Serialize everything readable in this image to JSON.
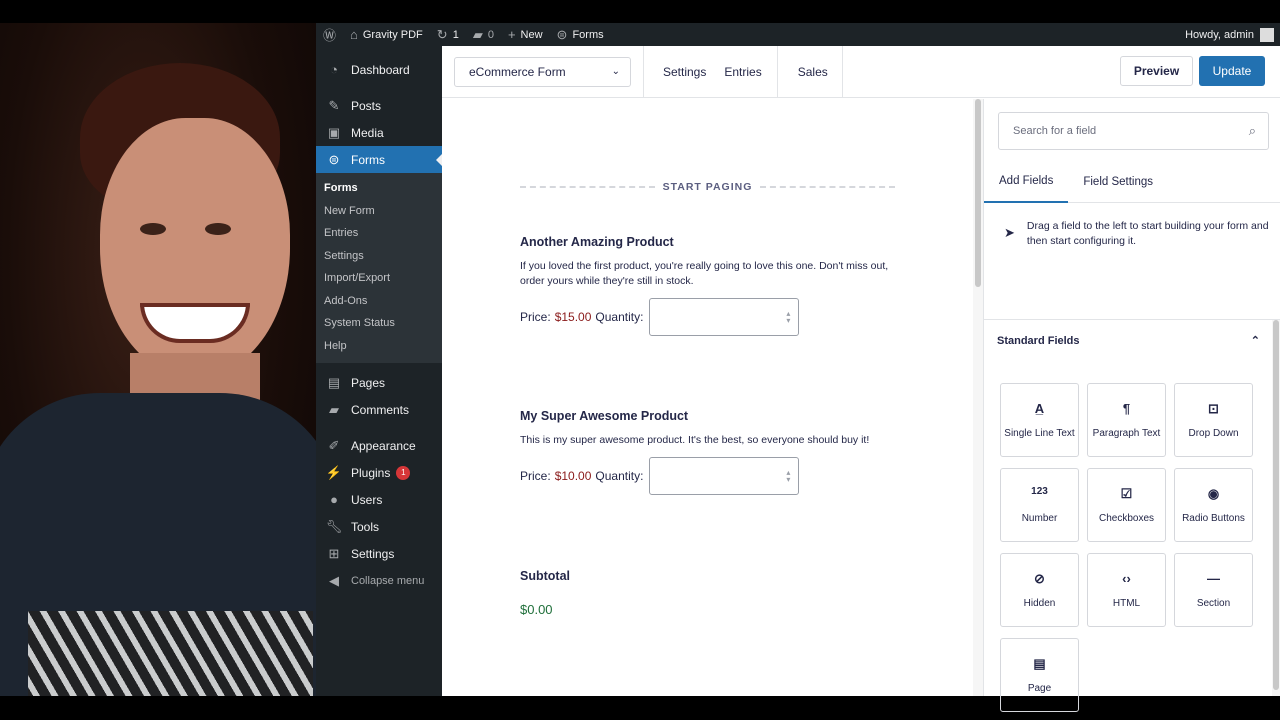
{
  "adminbar": {
    "site_name": "Gravity PDF",
    "updates_count": "1",
    "comments_count": "0",
    "new_label": "New",
    "forms_label": "Forms",
    "greeting": "Howdy, admin"
  },
  "sidebar": {
    "top_items": [
      {
        "label": "Dashboard",
        "icon": "dashboard-icon"
      },
      {
        "label": "Posts",
        "icon": "pin-icon"
      },
      {
        "label": "Media",
        "icon": "media-icon"
      },
      {
        "label": "Forms",
        "icon": "forms-icon"
      }
    ],
    "forms_submenu": [
      "Forms",
      "New Form",
      "Entries",
      "Settings",
      "Import/Export",
      "Add-Ons",
      "System Status",
      "Help"
    ],
    "bottom_items": [
      {
        "label": "Pages",
        "icon": "pages-icon"
      },
      {
        "label": "Comments",
        "icon": "comment-icon"
      },
      {
        "label": "Appearance",
        "icon": "brush-icon"
      },
      {
        "label": "Plugins",
        "icon": "plugin-icon",
        "badge": "1"
      },
      {
        "label": "Users",
        "icon": "users-icon"
      },
      {
        "label": "Tools",
        "icon": "wrench-icon"
      },
      {
        "label": "Settings",
        "icon": "settings-icon"
      }
    ],
    "collapse_label": "Collapse menu"
  },
  "toolbar": {
    "form_name": "eCommerce Form",
    "links": [
      "Settings",
      "Entries",
      "Sales"
    ],
    "preview_label": "Preview",
    "update_label": "Update"
  },
  "canvas": {
    "paging_label": "START PAGING",
    "products": [
      {
        "title": "Another Amazing Product",
        "description": "If you loved the first product, you're really going to love this one. Don't miss out, order yours while they're still in stock.",
        "price_label": "Price:",
        "price": "$15.00",
        "quantity_label": "Quantity:"
      },
      {
        "title": "My Super Awesome Product",
        "description": "This is my super awesome product. It's the best, so everyone should buy it!",
        "price_label": "Price:",
        "price": "$10.00",
        "quantity_label": "Quantity:"
      }
    ],
    "subtotal_title": "Subtotal",
    "subtotal_value": "$0.00"
  },
  "panel": {
    "search_placeholder": "Search for a field",
    "tabs": [
      "Add Fields",
      "Field Settings"
    ],
    "hint": "Drag a field to the left to start building your form and then start configuring it.",
    "section_title": "Standard Fields",
    "fields": [
      {
        "label": "Single Line Text",
        "icon": "A̲"
      },
      {
        "label": "Paragraph Text",
        "icon": "¶"
      },
      {
        "label": "Drop Down",
        "icon": "⊡"
      },
      {
        "label": "Number",
        "icon": "123"
      },
      {
        "label": "Checkboxes",
        "icon": "☑"
      },
      {
        "label": "Radio Buttons",
        "icon": "◉"
      },
      {
        "label": "Hidden",
        "icon": "⊘"
      },
      {
        "label": "HTML",
        "icon": "‹›"
      },
      {
        "label": "Section",
        "icon": "—"
      },
      {
        "label": "Page",
        "icon": "▤"
      }
    ]
  },
  "colors": {
    "accent": "#2271b1",
    "admin_dark": "#1d2327",
    "price_red": "#8a1a1a",
    "subtotal_green": "#1f6f3a"
  }
}
